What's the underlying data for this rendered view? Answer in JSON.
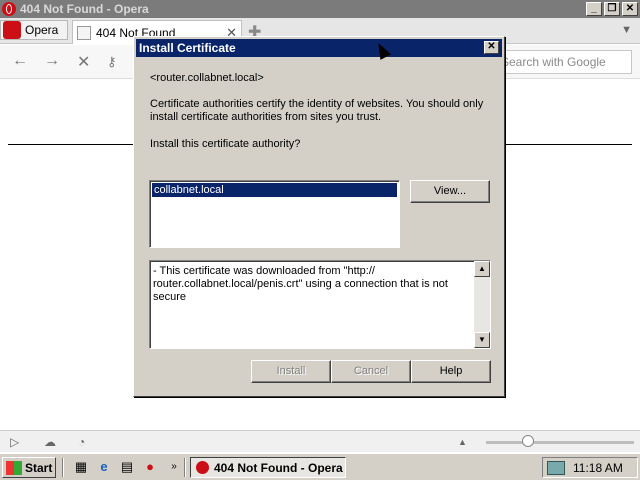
{
  "window": {
    "title": "404 Not Found - Opera"
  },
  "browser": {
    "menu_label": "Opera",
    "tab_title": "404 Not Found",
    "search_placeholder": "Search with Google"
  },
  "dialog": {
    "title": "Install Certificate",
    "site": "<router.collabnet.local>",
    "explanation": "Certificate authorities certify the identity of websites. You should only install certificate authorities from sites you trust.",
    "question": "Install this certificate authority?",
    "certificates": [
      "collabnet.local"
    ],
    "view_label": "View...",
    "info": "- This certificate was downloaded from \"http:// router.collabnet.local/penis.crt\" using a connection that is not secure",
    "install_label": "Install",
    "cancel_label": "Cancel",
    "help_label": "Help"
  },
  "taskbar": {
    "start_label": "Start",
    "task_label": "404 Not Found - Opera",
    "clock": "11:18 AM"
  }
}
